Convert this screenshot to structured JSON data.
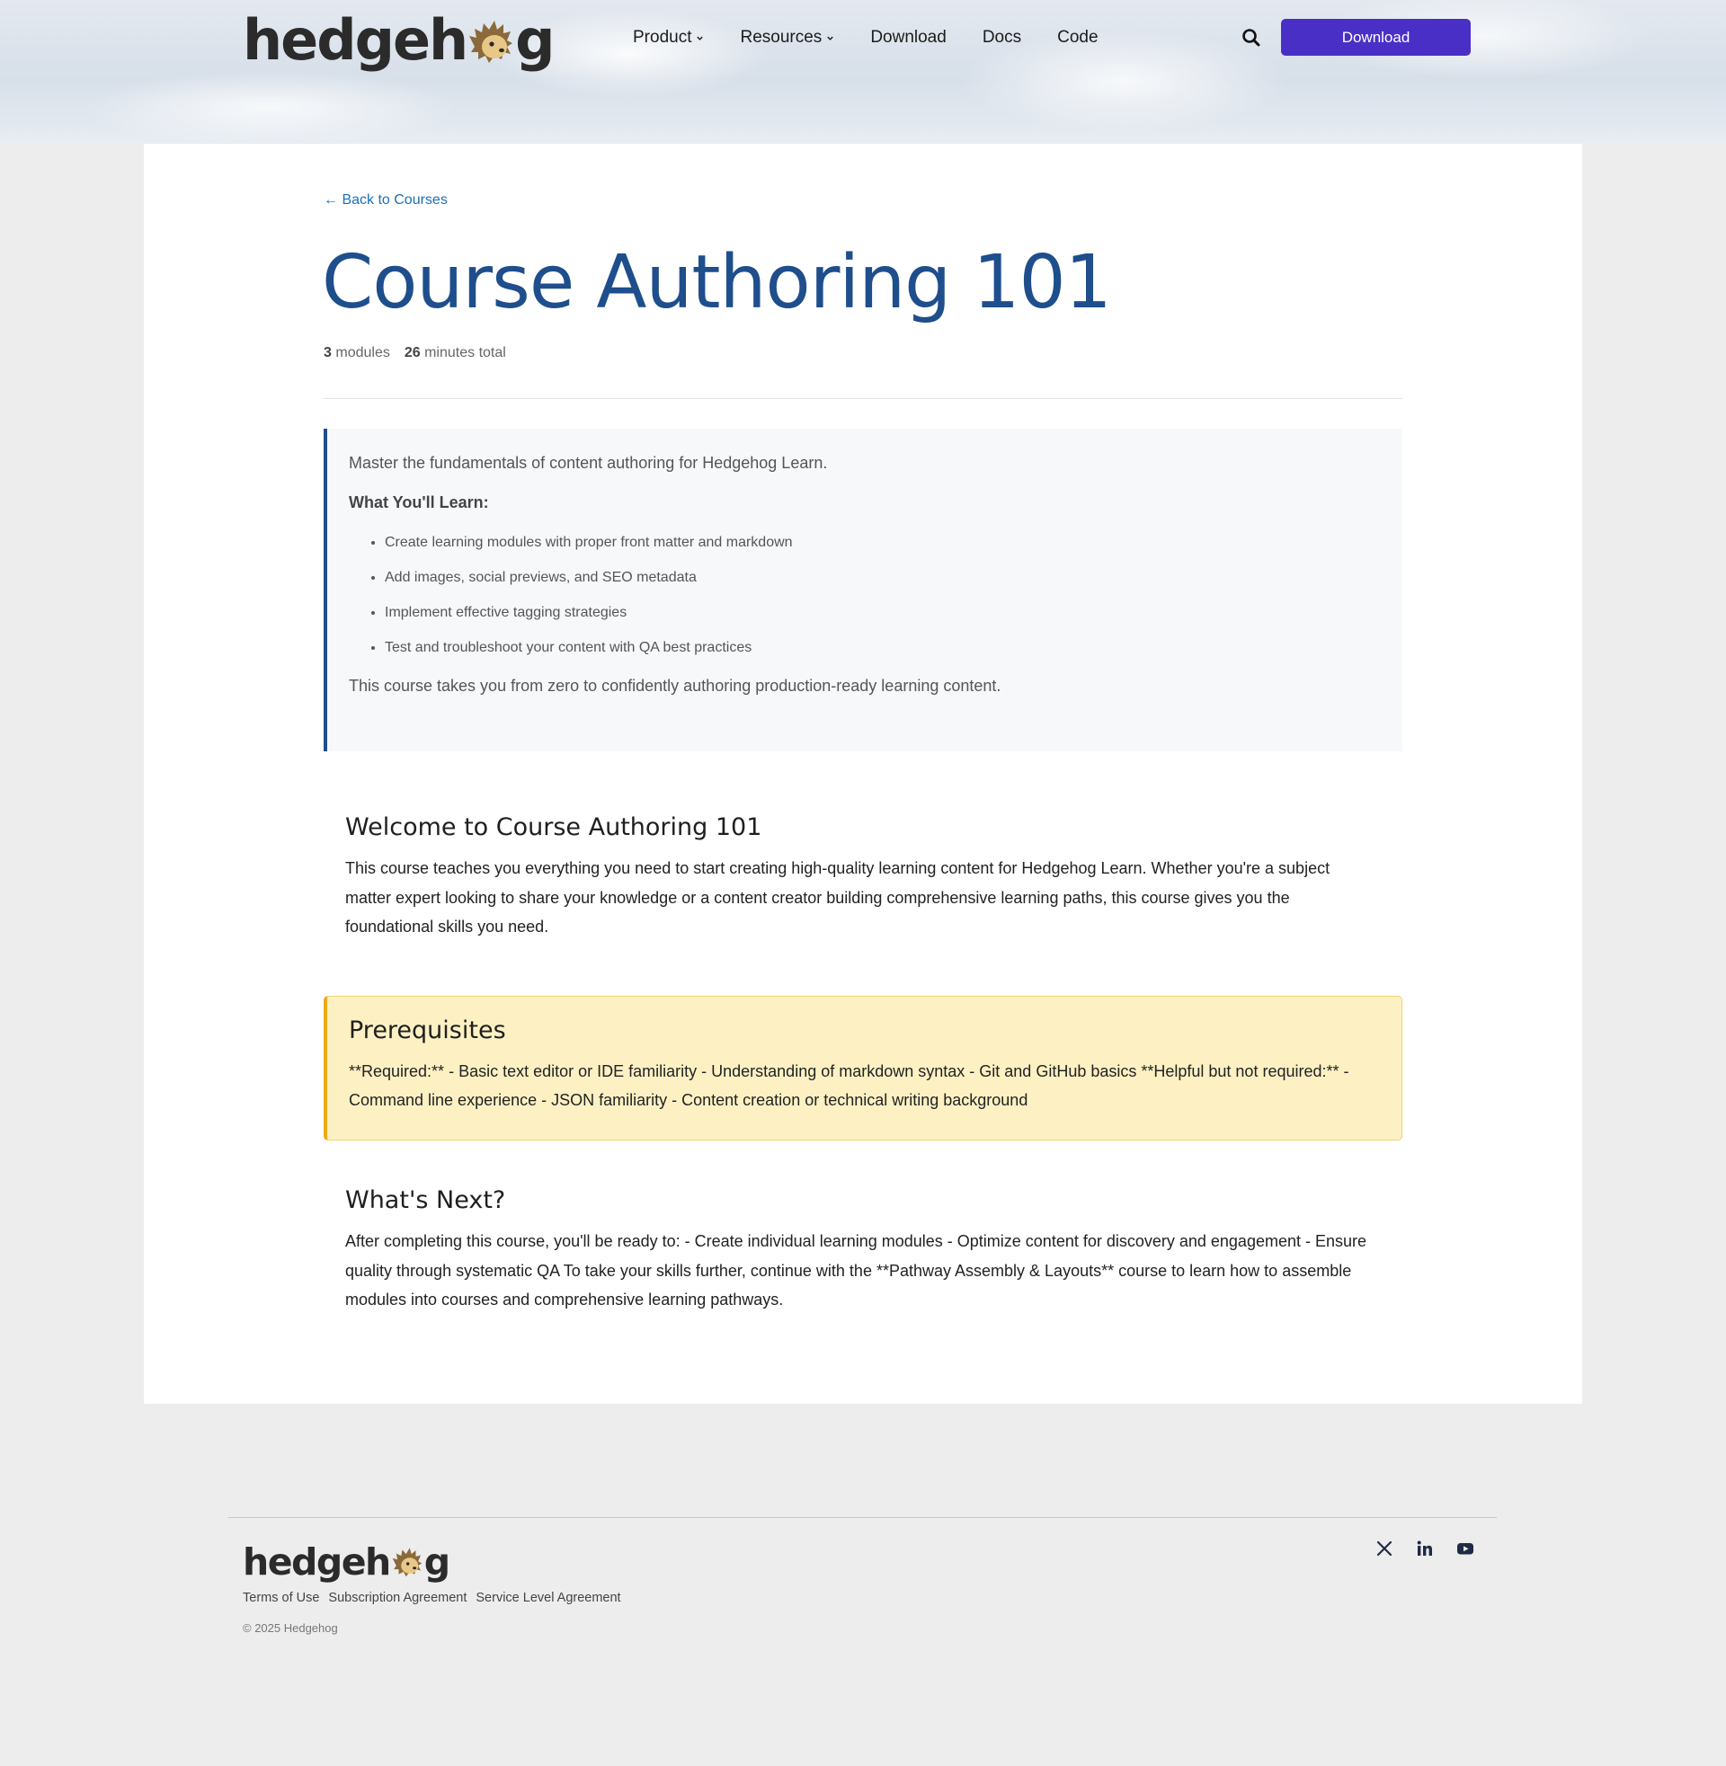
{
  "header": {
    "logo_text_left": "hedgeh",
    "logo_text_right": "g",
    "nav": [
      {
        "label": "Product",
        "has_dropdown": true
      },
      {
        "label": "Resources",
        "has_dropdown": true
      },
      {
        "label": "Download",
        "has_dropdown": false
      },
      {
        "label": "Docs",
        "has_dropdown": false
      },
      {
        "label": "Code",
        "has_dropdown": false
      }
    ],
    "search_icon": "search-icon",
    "download_button": "Download",
    "accent_color": "#4a2fc7"
  },
  "course": {
    "back_link": "← Back to Courses",
    "title": "Course Authoring 101",
    "modules_count": "3",
    "modules_label": "modules",
    "minutes_count": "26",
    "minutes_label": "minutes total",
    "title_color": "#1e4e8c"
  },
  "summary": {
    "intro": "Master the fundamentals of content authoring for Hedgehog Learn.",
    "learn_title": "What You'll Learn:",
    "learn_items": [
      "Create learning modules with proper front matter and markdown",
      "Add images, social previews, and SEO metadata",
      "Implement effective tagging strategies",
      "Test and troubleshoot your content with QA best practices"
    ],
    "outro": "This course takes you from zero to confidently authoring production-ready learning content."
  },
  "welcome": {
    "heading": "Welcome to Course Authoring 101",
    "body": "This course teaches you everything you need to start creating high-quality learning content for Hedgehog Learn. Whether you're a subject matter expert looking to share your knowledge or a content creator building comprehensive learning paths, this course gives you the foundational skills you need."
  },
  "prerequisites": {
    "heading": "Prerequisites",
    "body": "**Required:** - Basic text editor or IDE familiarity - Understanding of markdown syntax - Git and GitHub basics **Helpful but not required:** - Command line experience - JSON familiarity - Content creation or technical writing background",
    "bg_color": "#fdf1c4",
    "border_color": "#f0a814"
  },
  "whats_next": {
    "heading": "What's Next?",
    "body": "After completing this course, you'll be ready to: - Create individual learning modules - Optimize content for discovery and engagement - Ensure quality through systematic QA To take your skills further, continue with the **Pathway Assembly & Layouts** course to learn how to assemble modules into courses and comprehensive learning pathways."
  },
  "footer": {
    "logo_text_left": "hedgeh",
    "logo_text_right": "g",
    "links": [
      "Terms of Use",
      "Subscription Agreement",
      "Service Level Agreement"
    ],
    "copyright": "© 2025 Hedgehog",
    "social_icons": [
      "x-twitter-icon",
      "linkedin-icon",
      "youtube-icon"
    ]
  }
}
